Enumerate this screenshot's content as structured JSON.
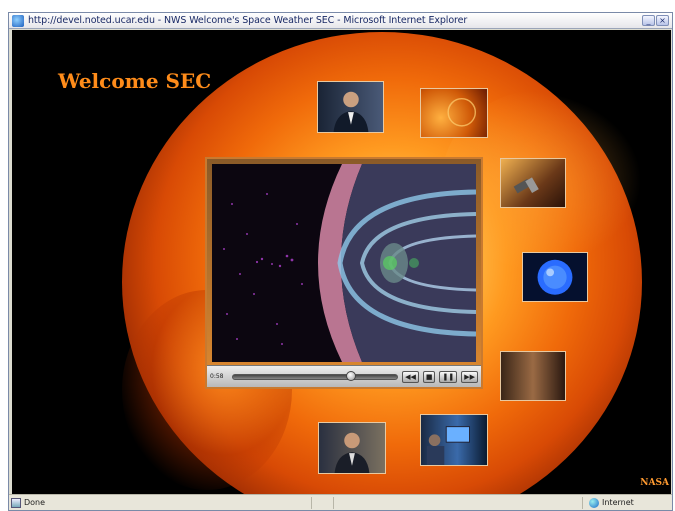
{
  "window": {
    "title": "http://devel.noted.ucar.edu - NWS Welcome's Space Weather SEC - Microsoft Internet Explorer",
    "minimize_glyph": "_",
    "close_glyph": "×"
  },
  "page": {
    "heading": "Welcome SEC",
    "credit": "NASA"
  },
  "thumbnails": [
    {
      "label": "presenter-1",
      "colors": [
        "#1a2435",
        "#4a5a78"
      ]
    },
    {
      "label": "solar-surface",
      "colors": [
        "#ff9a20",
        "#b83a05"
      ]
    },
    {
      "label": "satellite",
      "colors": [
        "#e8a040",
        "#3a2010"
      ]
    },
    {
      "label": "blue-sun",
      "colors": [
        "#3a7cff",
        "#05102e"
      ]
    },
    {
      "label": "lab",
      "colors": [
        "#8a6040",
        "#2a1810"
      ]
    },
    {
      "label": "presenter-2",
      "colors": [
        "#2a3040",
        "#7a7060"
      ]
    },
    {
      "label": "control-room",
      "colors": [
        "#2a5a9a",
        "#0a1a30"
      ]
    }
  ],
  "player": {
    "time": "0:58",
    "progress": 0.72,
    "rewind_glyph": "◀◀",
    "stop_glyph": "■",
    "pause_glyph": "❚❚",
    "forward_glyph": "▶▶"
  },
  "status": {
    "text": "Done",
    "zone": "Internet"
  }
}
